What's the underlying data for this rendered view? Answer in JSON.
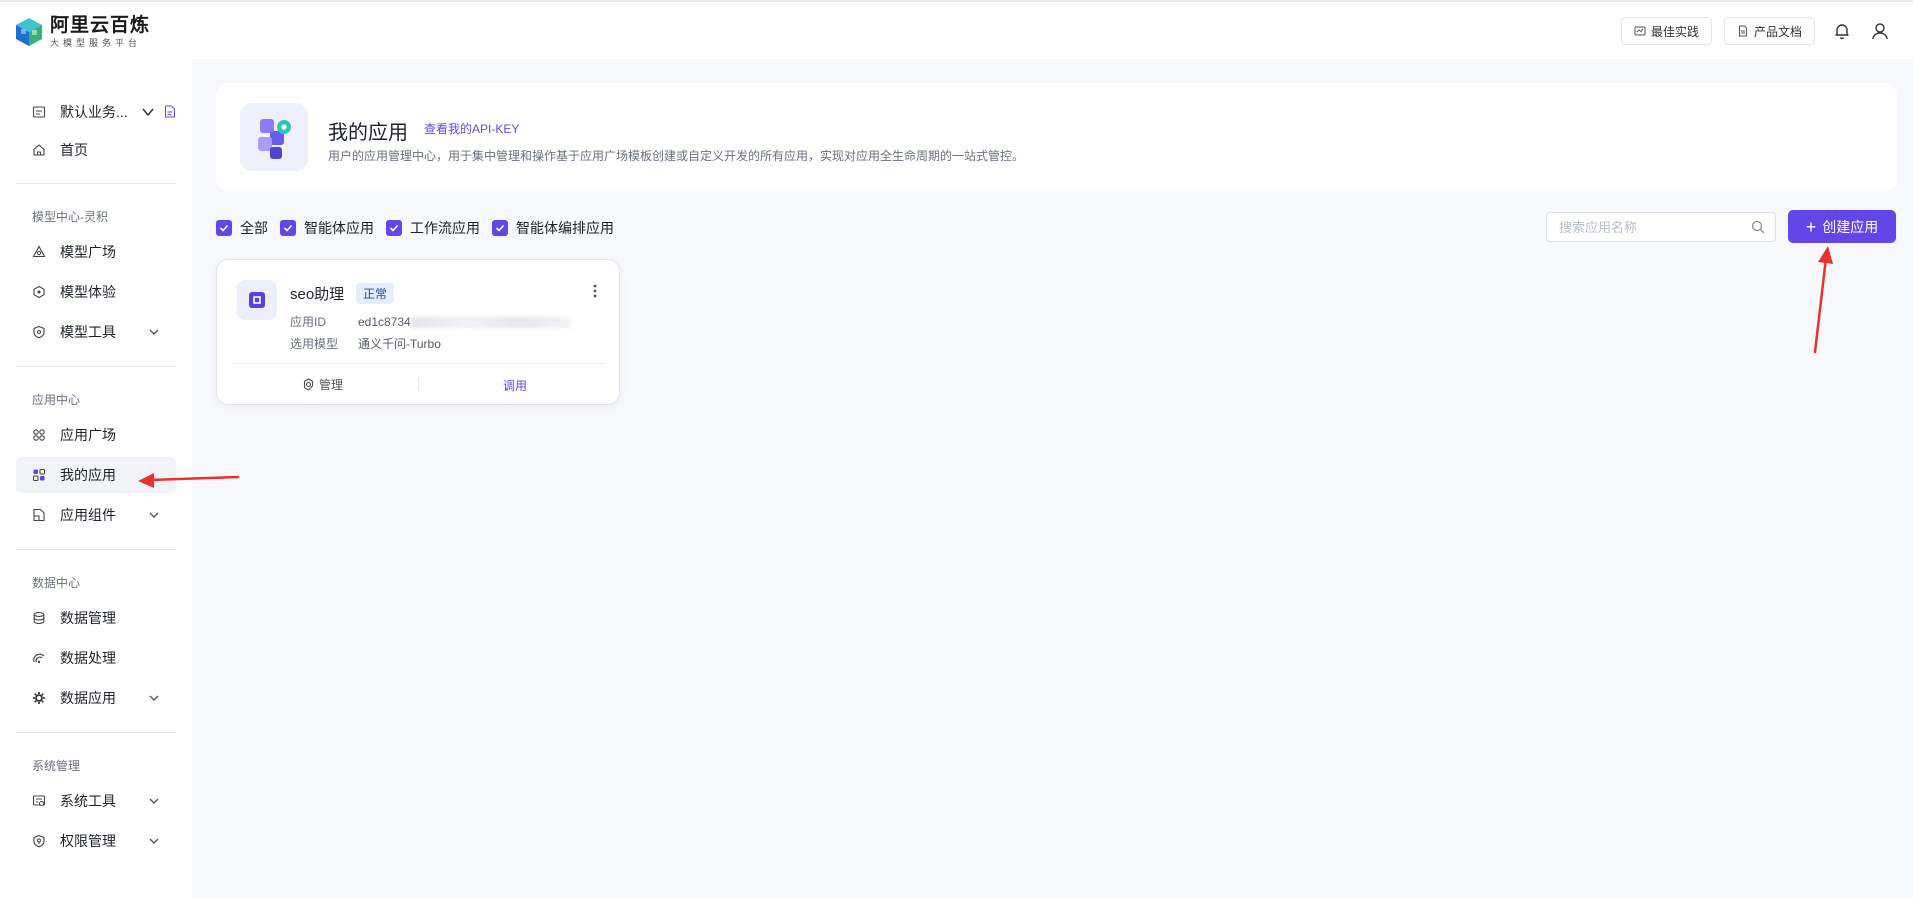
{
  "brand": {
    "title": "阿里云百炼",
    "subtitle": "大模型服务平台"
  },
  "top_actions": [
    {
      "label": "最佳实践",
      "icon": "practice-icon"
    },
    {
      "label": "产品文档",
      "icon": "doc-icon"
    }
  ],
  "top_icons": [
    "bell-icon",
    "user-icon"
  ],
  "sidebar": {
    "workspace": "默认业务...",
    "home": "首页",
    "sections": [
      {
        "title": "模型中心-灵积",
        "items": [
          {
            "label": "模型广场",
            "icon": "model-market-icon",
            "expandable": false
          },
          {
            "label": "模型体验",
            "icon": "model-try-icon",
            "expandable": false
          },
          {
            "label": "模型工具",
            "icon": "model-tool-icon",
            "expandable": true
          }
        ]
      },
      {
        "title": "应用中心",
        "items": [
          {
            "label": "应用广场",
            "icon": "app-market-icon",
            "expandable": false
          },
          {
            "label": "我的应用",
            "icon": "my-apps-icon",
            "expandable": false,
            "active": true
          },
          {
            "label": "应用组件",
            "icon": "app-component-icon",
            "expandable": true
          }
        ]
      },
      {
        "title": "数据中心",
        "items": [
          {
            "label": "数据管理",
            "icon": "database-icon",
            "expandable": false
          },
          {
            "label": "数据处理",
            "icon": "data-process-icon",
            "expandable": false
          },
          {
            "label": "数据应用",
            "icon": "data-app-icon",
            "expandable": true
          }
        ]
      },
      {
        "title": "系统管理",
        "items": [
          {
            "label": "系统工具",
            "icon": "system-tool-icon",
            "expandable": true
          },
          {
            "label": "权限管理",
            "icon": "permission-icon",
            "expandable": true
          }
        ]
      }
    ]
  },
  "header": {
    "title": "我的应用",
    "link": "查看我的API-KEY",
    "description": "用户的应用管理中心，用于集中管理和操作基于应用广场模板创建或自定义开发的所有应用，实现对应用全生命周期的一站式管控。"
  },
  "filters": [
    {
      "label": "全部",
      "checked": true
    },
    {
      "label": "智能体应用",
      "checked": true
    },
    {
      "label": "工作流应用",
      "checked": true
    },
    {
      "label": "智能体编排应用",
      "checked": true
    }
  ],
  "search": {
    "placeholder": "搜索应用名称",
    "value": ""
  },
  "create_button": "创建应用",
  "app": {
    "name": "seo助理",
    "status": "正常",
    "id_label": "应用ID",
    "id_value": "ed1c8734",
    "model_label": "选用模型",
    "model_value": "通义千问-Turbo",
    "manage_label": "管理",
    "call_label": "调用"
  },
  "colors": {
    "accent": "#6246ea",
    "annotation_arrow": "#e8322d",
    "background": "#f7f8fc"
  }
}
